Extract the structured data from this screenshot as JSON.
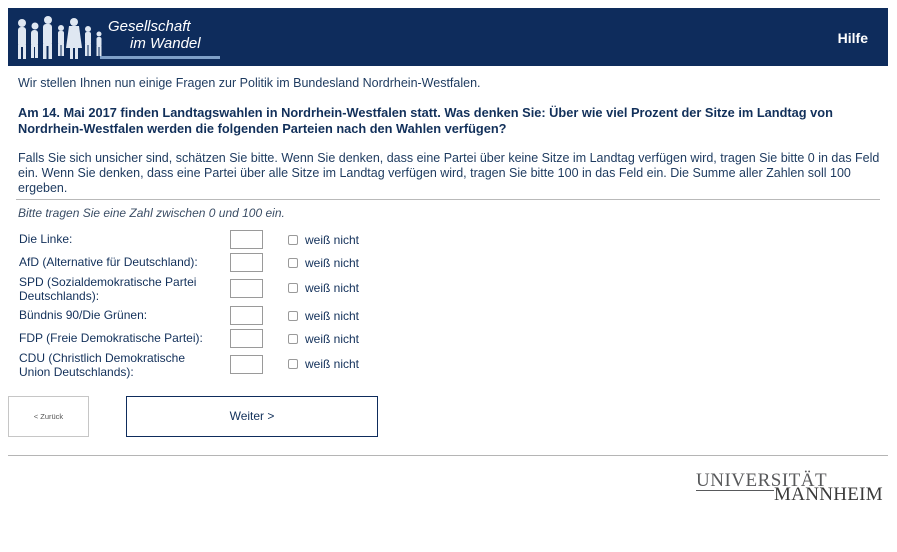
{
  "header": {
    "logo_line1": "Gesellschaft",
    "logo_line2": "im Wandel",
    "help_label": "Hilfe",
    "bg_color": "#0e2c5c"
  },
  "intro": "Wir stellen Ihnen nun einige Fragen zur Politik im Bundesland Nordrhein-Westfalen.",
  "question": "Am 14. Mai 2017 finden Landtagswahlen in Nordrhein-Westfalen statt. Was denken Sie: Über wie viel Prozent der Sitze im Landtag von Nordrhein-Westfalen werden die folgenden Parteien nach den Wahlen verfügen?",
  "instruction": "Falls Sie sich unsicher sind, schätzen Sie bitte. Wenn Sie denken, dass eine Partei über keine Sitze im Landtag verfügen wird, tragen Sie bitte 0 in das Feld ein. Wenn Sie denken, dass eine Partei über alle Sitze im Landtag verfügen wird, tragen Sie bitte 100 in das Feld ein. Die Summe aller Zahlen soll 100 ergeben.",
  "hint": "Bitte tragen Sie eine Zahl zwischen 0 und 100 ein.",
  "parties": [
    {
      "label": "Die Linke:",
      "value": "",
      "dont_know": "weiß nicht"
    },
    {
      "label": "AfD (Alternative für Deutschland):",
      "value": "",
      "dont_know": "weiß nicht"
    },
    {
      "label": "SPD (Sozialdemokratische Partei Deutschlands):",
      "value": "",
      "dont_know": "weiß nicht"
    },
    {
      "label": "Bündnis 90/Die Grünen:",
      "value": "",
      "dont_know": "weiß nicht"
    },
    {
      "label": "FDP (Freie Demokratische Partei):",
      "value": "",
      "dont_know": "weiß nicht"
    },
    {
      "label": "CDU (Christlich Demokratische Union Deutschlands):",
      "value": "",
      "dont_know": "weiß nicht"
    }
  ],
  "nav": {
    "back_label": "< Zurück",
    "next_label": "Weiter >"
  },
  "university": {
    "line1": "UNIVERSITÄT",
    "line2": "MANNHEIM"
  }
}
